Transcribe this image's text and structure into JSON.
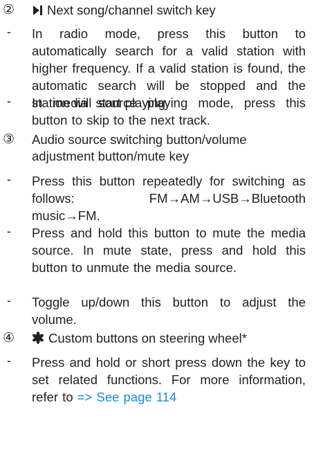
{
  "sections": [
    {
      "number": "②",
      "icon": "next-track-icon",
      "title": "Next song/channel switch key",
      "items": [
        "In radio mode, press this button to automatically search for a valid station with higher frequency. If a valid station is found, the automatic search will be stopped and the station will start playing.",
        "In media source playing mode, press this button to skip to the next track."
      ]
    },
    {
      "number": "③",
      "title_lines": [
        "Audio source switching button/volume",
        "adjustment button/mute key"
      ],
      "items": [
        "Press this button repeatedly for switching as follows: FM→AM→USB→Bluetooth music→FM.",
        "Press and hold this button to mute the media source. In mute state, press and hold this button to unmute the media source.",
        "Toggle up/down this button to adjust the volume."
      ]
    },
    {
      "number": "④",
      "icon": "asterisk-star-icon",
      "title": "Custom buttons on steering wheel*",
      "items_prefix": "Press and hold or short press down the key to set related functions. For more information, refer to ",
      "link": "=> See page 114"
    }
  ],
  "bullet": "-",
  "colors": {
    "text": "#231f20",
    "link": "#1a8bd8"
  }
}
